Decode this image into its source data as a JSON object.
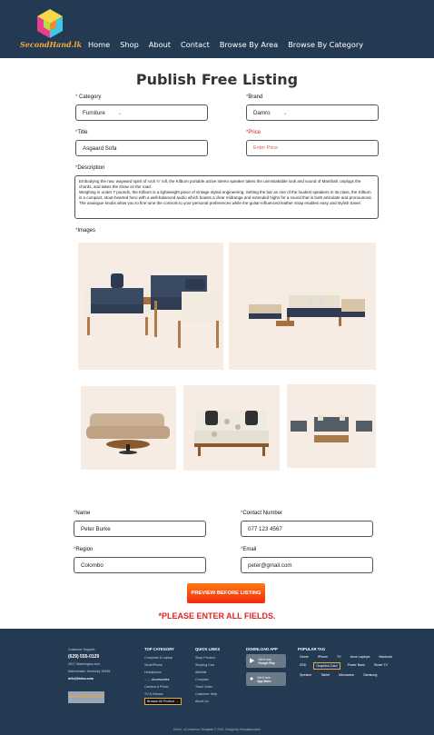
{
  "header": {
    "logo_text": "SecondHand.lk",
    "nav": [
      "Home",
      "Shop",
      "About",
      "Contact",
      "Browse By Area",
      "Browse By Category"
    ]
  },
  "page_title": "Publish Free Listing",
  "form": {
    "category_label": "Category",
    "category_value": "Furniture",
    "brand_label": "Brand",
    "brand_value": "Damro",
    "title_label": "Title",
    "title_value": "Asgaard Sofa",
    "price_label": "Price",
    "price_placeholder": "Enter Price",
    "description_label": "Description",
    "description_value": "Embodying the raw, wayward spirit of rock 'n' roll, the Kilburn portable active stereo speaker takes the unmistakable look and sound of Marshall, unplugs the chords, and takes the show on the road.\nWeighing in under 7 pounds, the Kilburn is a lightweight piece of vintage styled engineering. Setting the bar as one of the loudest speakers in its class, the Kilburn is a compact, stout-hearted hero with a well-balanced audio which boasts a clear midrange and extended highs for a sound that is both articulate and pronounced. The analogue knobs allow you to fine tune the controls to your personal preferences while the guitar-influenced leather strap enables easy and stylish travel.",
    "images_label": "Images",
    "name_label": "Name",
    "name_value": "Peter Burke",
    "contact_label": "Contact Number",
    "contact_value": "077 123 4567",
    "region_label": "Region",
    "region_value": "Colombo",
    "email_label": "Email",
    "email_value": "peter@gmail.com",
    "preview_button": "PREVIEW BEFORE LISTING",
    "error_message": "*PLEASE ENTER ALL FIELDS."
  },
  "footer": {
    "support_label": "Customer Support:",
    "phone": "(629) 555-0129",
    "address_line1": "4517 Washington Ave.",
    "address_line2": "Manchester, Kentucky 39495",
    "email": "info@kinbo.com",
    "top_category_heading": "TOP CATEGORY",
    "top_categories": [
      "Computer & Laptop",
      "SmartPhone",
      "Headphone",
      "Accessories",
      "Camera & Photo",
      "TV & Homes"
    ],
    "shop_all": "Browse All Product",
    "quick_links_heading": "QUICK LINKS",
    "quick_links": [
      "Shop Product",
      "Shoping Cart",
      "Wishlist",
      "Compare",
      "Track Order",
      "Customer Help",
      "About Us"
    ],
    "download_heading": "DOWNLOAD APP",
    "google_play_small": "Get it now",
    "google_play": "Google Play",
    "app_store_small": "Get it now",
    "app_store": "App Store",
    "tags_heading": "POPULAR TAG",
    "tags": [
      "Game",
      "iPhone",
      "TV",
      "Asus Laptops",
      "Macbook",
      "SSD",
      "Graphics Card",
      "Power Bank",
      "Smart TV",
      "Speaker",
      "Tablet",
      "Microwave",
      "Samsung"
    ],
    "selected_tag": "Graphics Card",
    "logo_text": "SecondHand.lk",
    "copyright": "Kinbo - eCommerce Template © 2021. Design by Templatecookie"
  },
  "colors": {
    "header_bg": "#243a53",
    "accent": "#f4a93c",
    "error": "#e32222",
    "button_gradient_top": "#ff7a12",
    "button_gradient_bottom": "#f02a10"
  }
}
